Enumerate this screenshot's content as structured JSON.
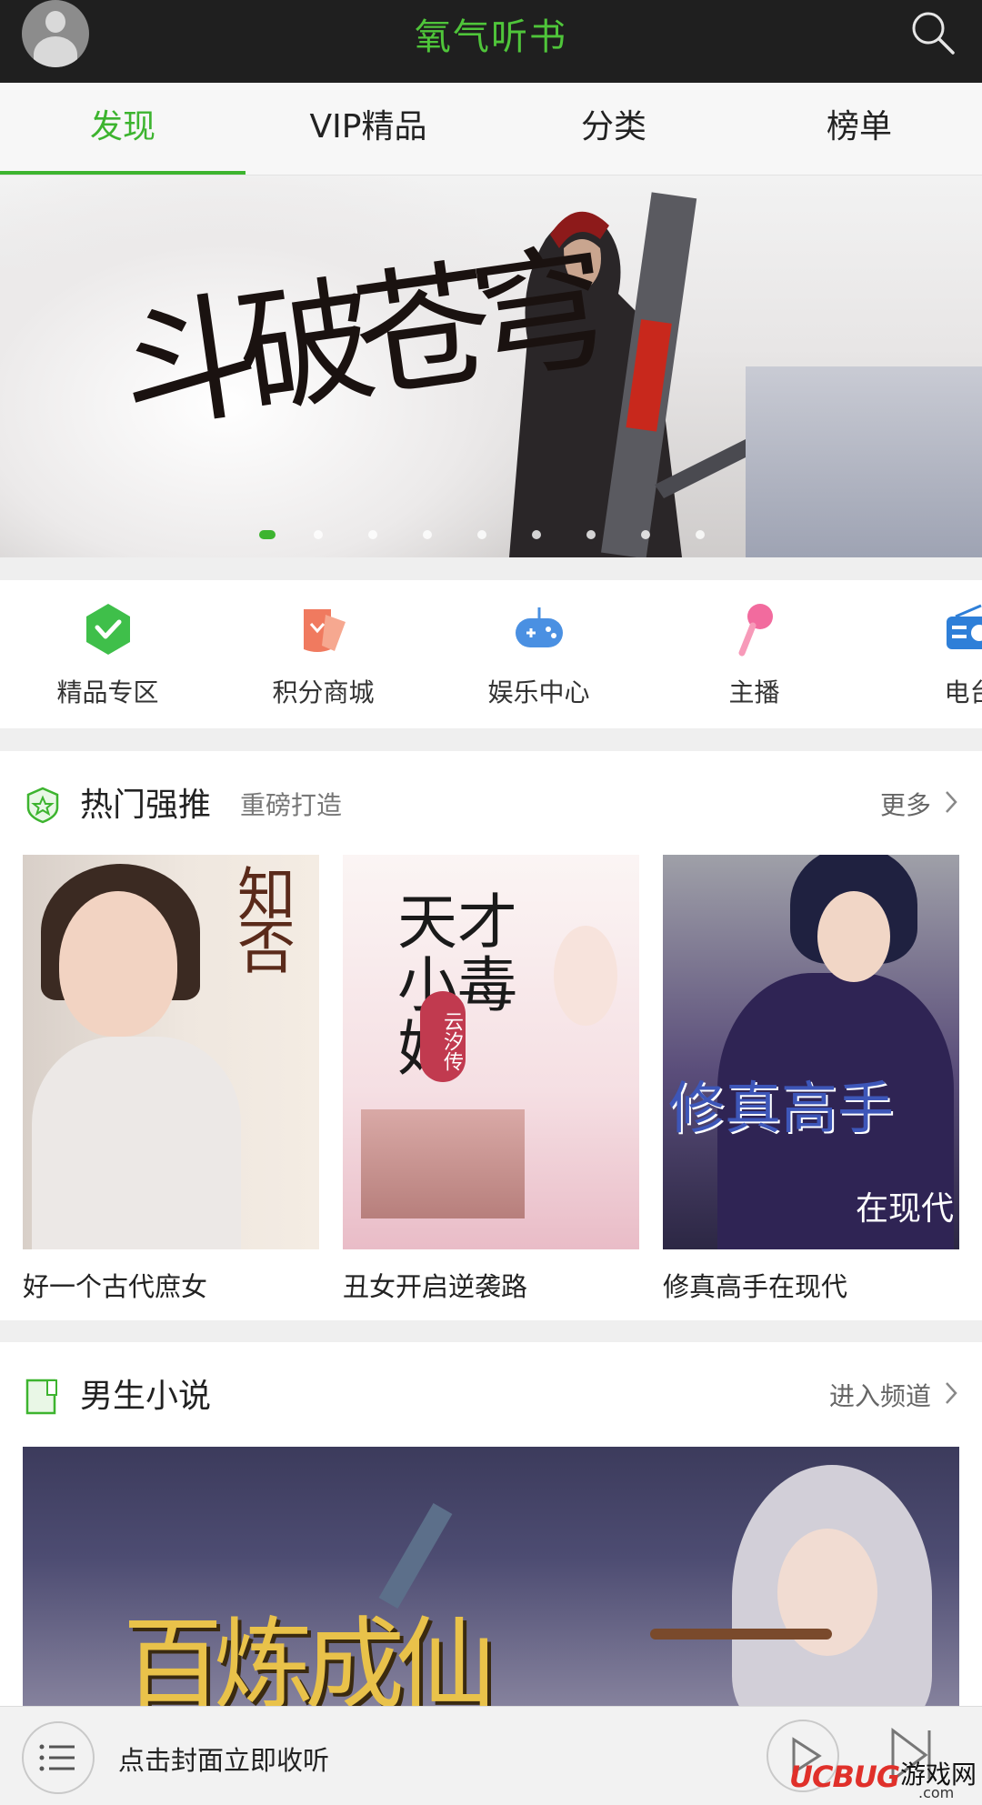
{
  "header": {
    "app_title": "氧气听书"
  },
  "tabs": [
    {
      "label": "发现",
      "active": true
    },
    {
      "label": "VIP精品",
      "active": false
    },
    {
      "label": "分类",
      "active": false
    },
    {
      "label": "榜单",
      "active": false
    }
  ],
  "banner": {
    "dot_count": 9,
    "active_index": 0
  },
  "quick_menu": [
    {
      "label": "精品专区",
      "icon": "premium-badge-icon",
      "color": "#3fbf4a"
    },
    {
      "label": "积分商城",
      "icon": "points-ticket-icon",
      "color": "#f07a5f"
    },
    {
      "label": "娱乐中心",
      "icon": "gamepad-icon",
      "color": "#4a90e2"
    },
    {
      "label": "主播",
      "icon": "microphone-icon",
      "color": "#f26b9e"
    },
    {
      "label": "电台",
      "icon": "radio-icon",
      "color": "#2e7fd8"
    }
  ],
  "hot_section": {
    "title": "热门强推",
    "subtitle": "重磅打造",
    "more_label": "更多",
    "books": [
      {
        "title": "好一个古代庶女",
        "cover_text": "知否"
      },
      {
        "title": "丑女开启逆袭路",
        "cover_text_main": "天才小毒妃",
        "cover_badge": "云汐传"
      },
      {
        "title": "修真高手在现代",
        "cover_text_main": "修真高手",
        "cover_text_sub": "在现代"
      }
    ]
  },
  "male_section": {
    "title": "男生小说",
    "more_label": "进入频道",
    "banner_text": "百炼成仙"
  },
  "player": {
    "hint": "点击封面立即收听"
  },
  "watermark": {
    "brand": "UCBUG",
    "cn": "游戏网",
    "domain": ".com"
  },
  "colors": {
    "accent": "#3db42f",
    "title_green": "#4fc53a",
    "topbar": "#1f1f1f"
  }
}
